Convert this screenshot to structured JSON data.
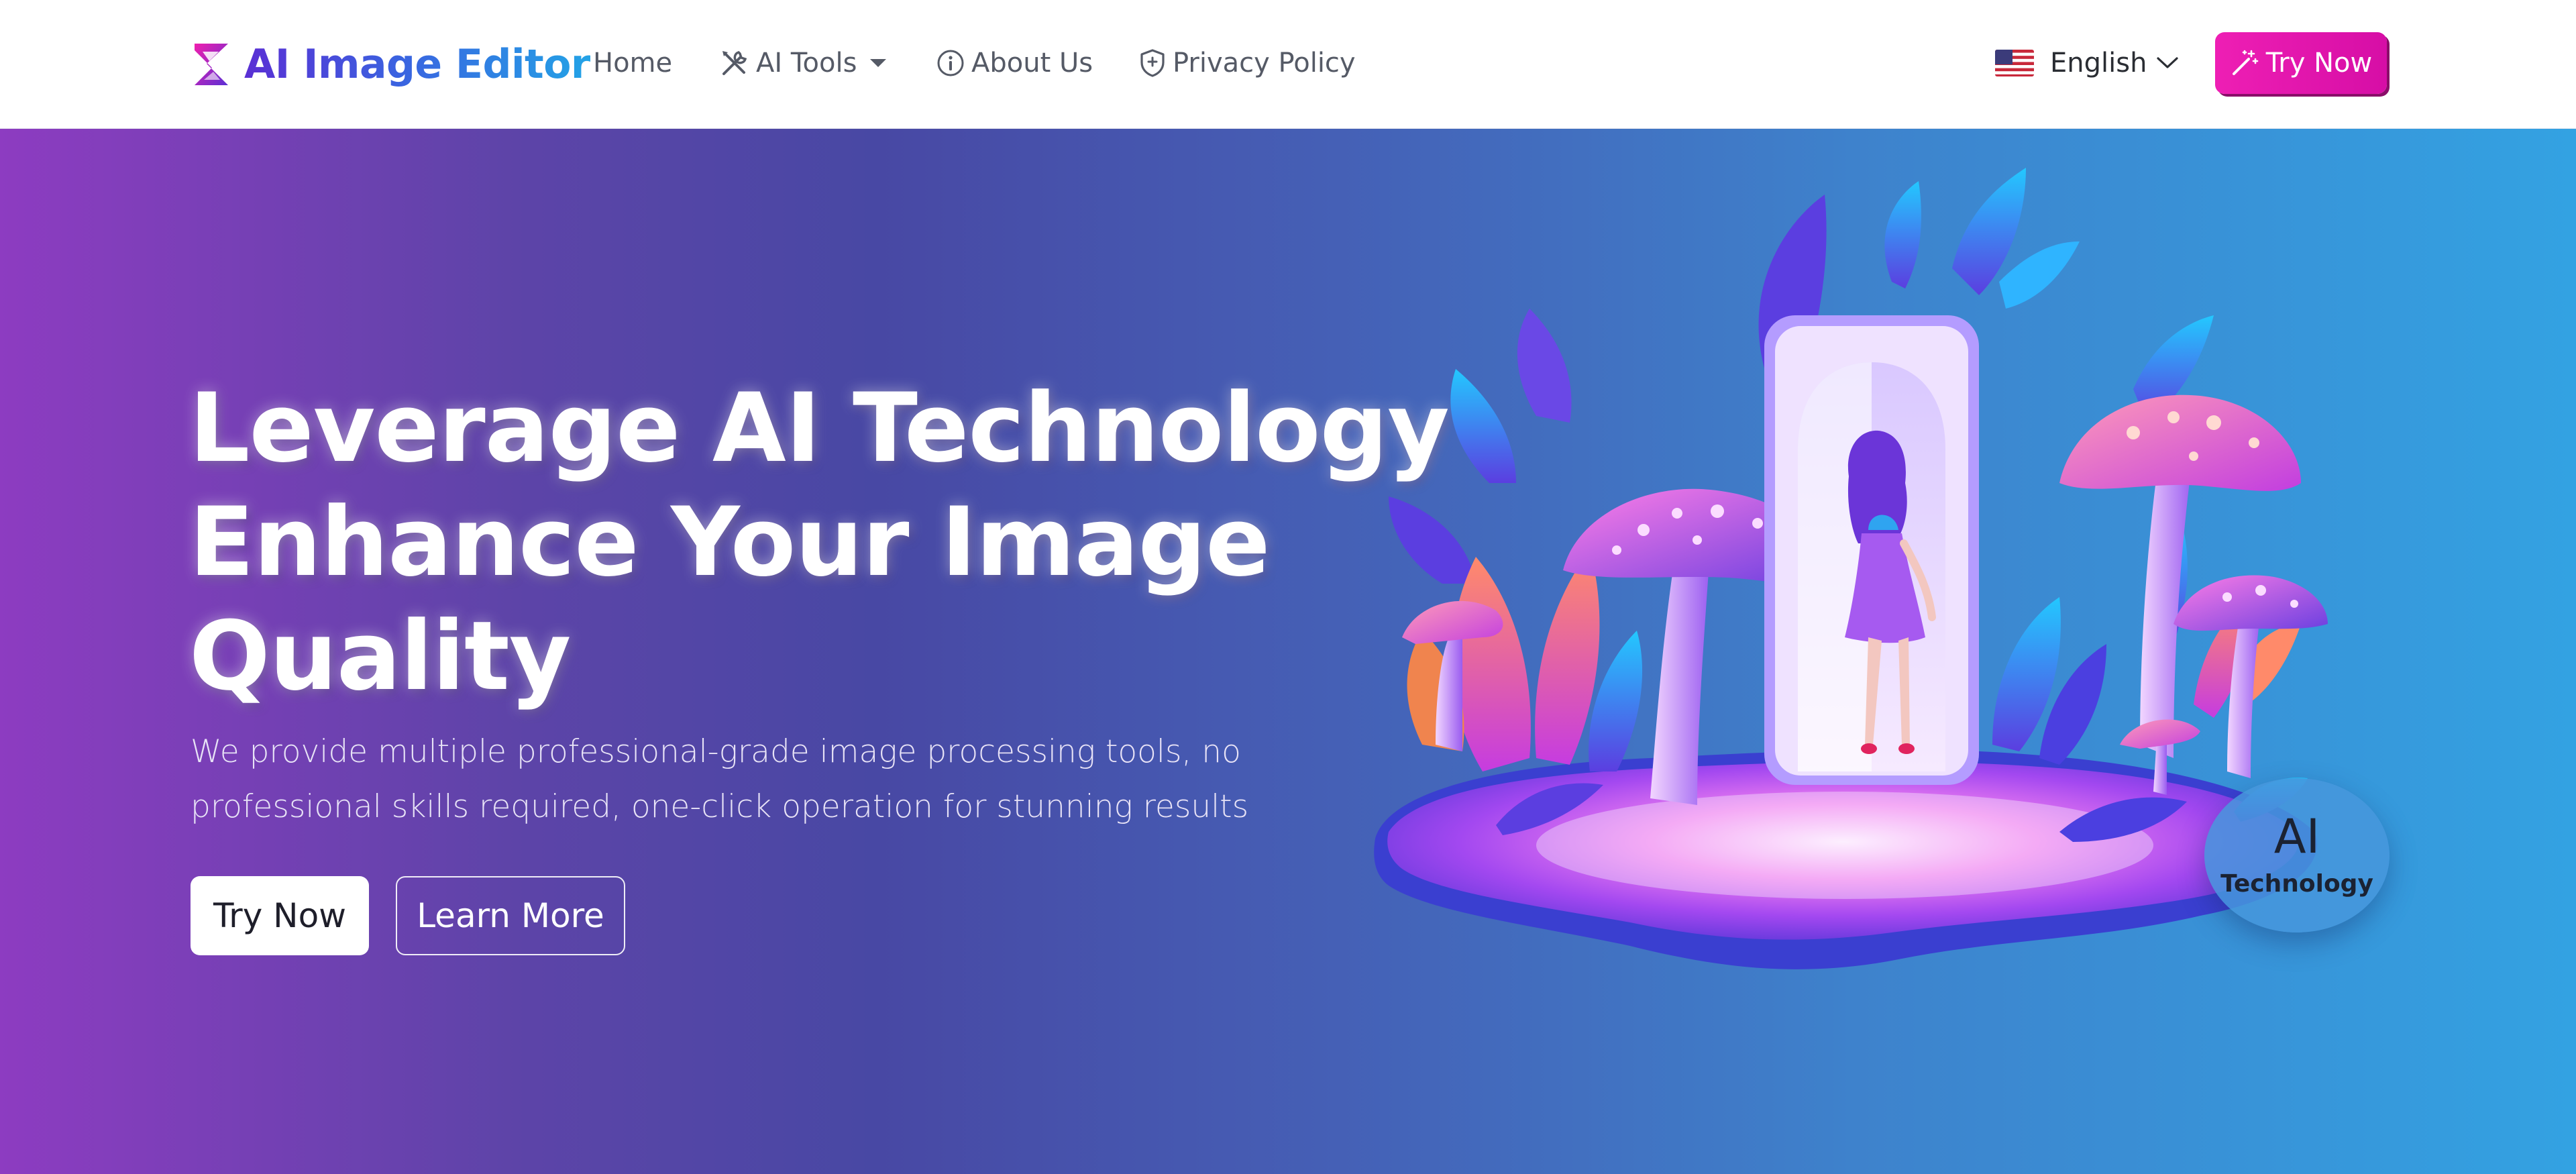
{
  "brand": {
    "name": "AI Image Editor",
    "logo_icon": "s-logo-icon"
  },
  "nav": {
    "items": [
      {
        "label": "Home"
      },
      {
        "label": "AI Tools",
        "icon": "tools-icon",
        "has_dropdown": true
      },
      {
        "label": "About Us",
        "icon": "info-icon"
      },
      {
        "label": "Privacy Policy",
        "icon": "shield-icon"
      }
    ],
    "language": {
      "label": "English",
      "icon": "us-flag-icon"
    },
    "cta_label": "Try Now",
    "cta_icon": "magic-wand-icon"
  },
  "hero": {
    "title_lines": [
      "Leverage AI Technology",
      "Enhance Your Image",
      "Quality"
    ],
    "subtitle_lines": [
      "We provide multiple professional-grade image processing tools, no",
      "professional skills required, one-click operation for stunning results"
    ],
    "primary_button": "Try Now",
    "secondary_button": "Learn More",
    "badge": {
      "big": "AI",
      "small": "Technology"
    }
  },
  "colors": {
    "brand_gradient": [
      "#5a2fd4",
      "#23a3e6"
    ],
    "cta_pink": "#e615b0",
    "hero_gradient": [
      "#8d3cc1",
      "#4848a4",
      "#33a2e2"
    ]
  }
}
